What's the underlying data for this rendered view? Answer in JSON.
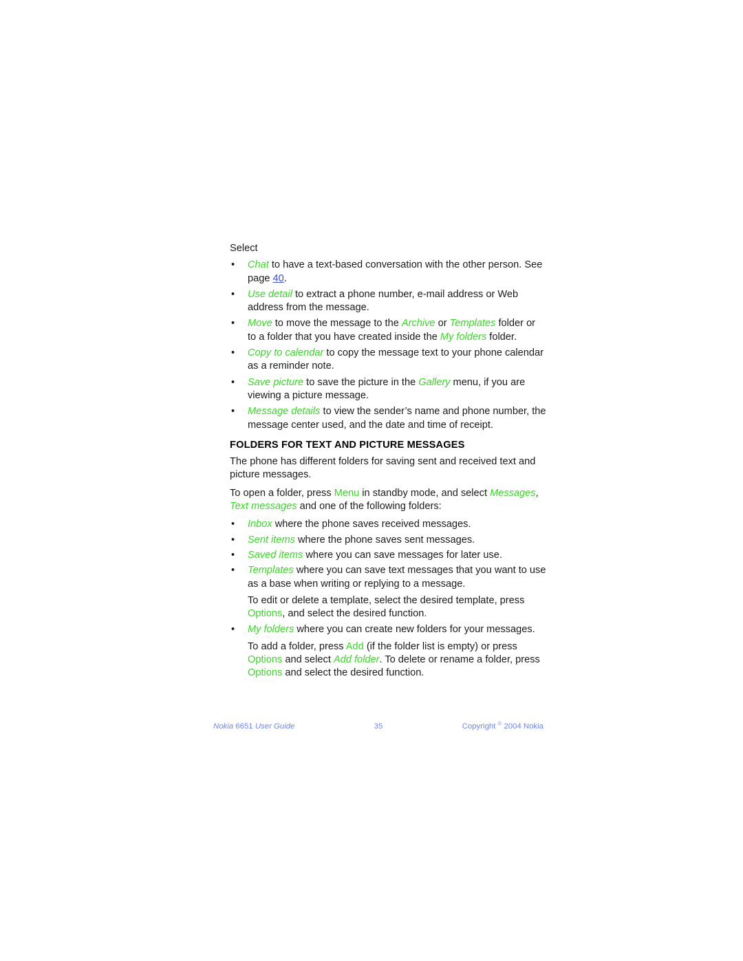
{
  "document": {
    "lead": "Select",
    "bullets_select": [
      {
        "term": "Chat",
        "rest_before_link": " to have a text-based conversation with the other person. See page ",
        "link": "40",
        "rest_after_link": "."
      },
      {
        "term": "Use detail",
        "rest": " to extract a phone number, e-mail address or Web address from the message."
      },
      {
        "term": "Move",
        "seg1": " to move the message to the ",
        "term2": "Archive",
        "seg2": " or ",
        "term3": "Templates",
        "seg3": " folder or to a folder that you have created inside the ",
        "term4": "My folders",
        "seg4": " folder."
      },
      {
        "term": "Copy to calendar",
        "rest": " to copy the message text to your phone calendar as a reminder note."
      },
      {
        "term": "Save picture",
        "seg1": " to save the picture in the ",
        "term2": "Gallery",
        "seg2": " menu, if you are viewing a picture message."
      },
      {
        "term": "Message details",
        "rest": " to view the sender’s name and phone number, the message center used, and the date and time of receipt."
      }
    ],
    "heading": "FOLDERS FOR TEXT AND PICTURE MESSAGES",
    "intro_para": "The phone has different folders for saving sent and received text and picture messages.",
    "open_folder_para": {
      "seg1": "To open a folder, press ",
      "key1": "Menu",
      "seg2": " in standby mode, and select ",
      "term1": "Messages",
      "seg3": ", ",
      "term2": "Text messages",
      "seg4": " and one of the following folders:"
    },
    "bullets_folders": [
      {
        "term": "Inbox",
        "rest": " where the phone saves received messages."
      },
      {
        "term": "Sent items",
        "rest": " where the phone saves sent messages."
      },
      {
        "term": "Saved items",
        "rest": " where you can save messages for later use."
      },
      {
        "term": "Templates",
        "rest": " where you can save text messages that you want to use as a base when writing or replying to a message."
      }
    ],
    "template_note": {
      "seg1": "To edit or delete a template, select the desired template, press ",
      "key1": "Options",
      "seg2": ", and select the desired function."
    },
    "my_folders_bullet": {
      "term": "My folders",
      "rest": " where you can create new folders for your messages."
    },
    "add_folder_note": {
      "seg1": "To add a folder, press ",
      "key1": "Add",
      "seg2": " (if the folder list is empty) or press ",
      "key2": "Options",
      "seg3": " and select ",
      "term1": "Add folder",
      "seg4": ". To delete or rename a folder, press ",
      "key3": "Options",
      "seg5": " and select the desired function."
    },
    "bullet_glyph": "•"
  },
  "footer": {
    "brand": "Nokia",
    "model": "6651",
    "guide": "User Guide",
    "page_number": "35",
    "copyright_word": "Copyright",
    "copyright_symbol": "©",
    "copyright_rest": "2004 Nokia"
  },
  "colors": {
    "ui_green": "#3cd42a",
    "link_blue": "#3b4fd0",
    "footer_blue": "#6e86e8",
    "body_text": "#1a1a1a",
    "page_background": "#ffffff"
  }
}
